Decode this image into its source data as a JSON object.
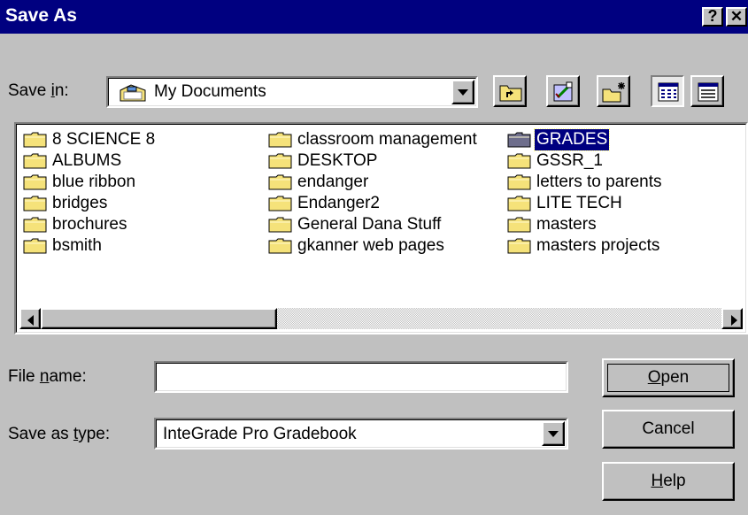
{
  "window": {
    "title": "Save As",
    "help_glyph": "?",
    "close_glyph": "✕"
  },
  "save_in": {
    "label_pre": "Save ",
    "label_mnemonic": "i",
    "label_post": "n:",
    "value": "My Documents",
    "icon": "my-documents-folder-icon"
  },
  "toolbar": {
    "buttons": [
      "up-one-level",
      "go-to-desktop",
      "create-new-folder",
      "list-view",
      "details-view"
    ]
  },
  "files": [
    {
      "name": "8 SCIENCE 8",
      "selected": false
    },
    {
      "name": "ALBUMS",
      "selected": false
    },
    {
      "name": "blue ribbon",
      "selected": false
    },
    {
      "name": "bridges",
      "selected": false
    },
    {
      "name": "brochures",
      "selected": false
    },
    {
      "name": "bsmith",
      "selected": false
    },
    {
      "name": "classroom management",
      "selected": false
    },
    {
      "name": "DESKTOP",
      "selected": false
    },
    {
      "name": "endanger",
      "selected": false
    },
    {
      "name": "Endanger2",
      "selected": false
    },
    {
      "name": "General Dana Stuff",
      "selected": false
    },
    {
      "name": "gkanner web pages",
      "selected": false
    },
    {
      "name": "GRADES",
      "selected": true
    },
    {
      "name": "GSSR_1",
      "selected": false
    },
    {
      "name": "letters to parents",
      "selected": false
    },
    {
      "name": "LITE TECH",
      "selected": false
    },
    {
      "name": "masters",
      "selected": false
    },
    {
      "name": "masters projects",
      "selected": false
    }
  ],
  "file_name": {
    "label_pre": "File ",
    "label_mnemonic": "n",
    "label_post": "ame:",
    "value": ""
  },
  "save_type": {
    "label_pre": "Save as ",
    "label_mnemonic": "t",
    "label_post": "ype:",
    "value": "InteGrade Pro Gradebook"
  },
  "buttons": {
    "open_mnemonic": "O",
    "open_rest": "pen",
    "cancel": "Cancel",
    "help_mnemonic": "H",
    "help_rest": "elp"
  },
  "colors": {
    "titlebar": "#000080",
    "face": "#c0c0c0",
    "selection": "#000080",
    "folder": "#f5e27a"
  }
}
